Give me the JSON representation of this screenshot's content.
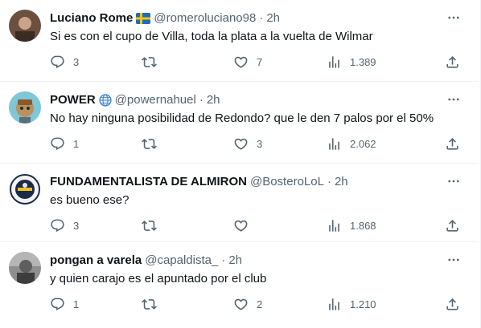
{
  "tweets": [
    {
      "name": "Luciano Rome",
      "badge": "sweden-flag",
      "handle": "@romeroluciano98",
      "time": "2h",
      "text": "Si es con el cupo de Villa, toda la plata a la vuelta de Wilmar",
      "replies": "3",
      "retweets": "",
      "likes": "7",
      "views": "1.389"
    },
    {
      "name": "POWER",
      "badge": "globe",
      "handle": "@powernahuel",
      "time": "2h",
      "text": "No hay ninguna posibilidad de Redondo? que le den 7 palos por el 50%",
      "replies": "1",
      "retweets": "",
      "likes": "3",
      "views": "2.062"
    },
    {
      "name": "FUNDAMENTALISTA DE ALMIRON",
      "badge": "",
      "handle": "@BosteroLoL",
      "time": "2h",
      "text": "es bueno ese?",
      "replies": "3",
      "retweets": "",
      "likes": "",
      "views": "1.868"
    },
    {
      "name": "pongan a varela",
      "badge": "",
      "handle": "@capaldista_",
      "time": "2h",
      "text": "y quien carajo es el apuntado por el club",
      "replies": "1",
      "retweets": "",
      "likes": "2",
      "views": "1.210"
    }
  ],
  "separator": "·",
  "colors": {
    "text": "#0f1419",
    "muted": "#536471",
    "border": "#eff3f4"
  }
}
